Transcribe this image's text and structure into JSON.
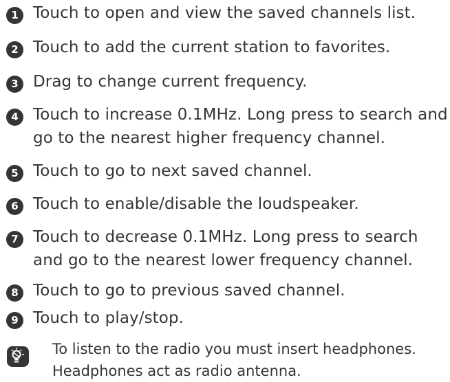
{
  "items": [
    {
      "number": "1",
      "lines": [
        "Touch to open and view the saved channels list."
      ]
    },
    {
      "number": "2",
      "lines": [
        "Touch to add the current station to favorites."
      ]
    },
    {
      "number": "3",
      "lines": [
        "Drag to change current frequency."
      ]
    },
    {
      "number": "4",
      "lines": [
        "Touch to increase 0.1MHz. Long press to search and",
        "go to the nearest higher frequency channel."
      ]
    },
    {
      "number": "5",
      "lines": [
        "Touch to go to next saved channel."
      ]
    },
    {
      "number": "6",
      "lines": [
        "Touch to enable/disable the loudspeaker."
      ]
    },
    {
      "number": "7",
      "lines": [
        "Touch to decrease 0.1MHz. Long press to search",
        "and go to the nearest lower frequency channel."
      ]
    },
    {
      "number": "8",
      "lines": [
        "Touch to go to previous saved channel."
      ]
    },
    {
      "number": "9",
      "lines": [
        "Touch to play/stop."
      ]
    }
  ],
  "tip": {
    "icon": "lightbulb-tip-icon",
    "lines": [
      "To listen to the radio you must insert headphones.",
      "Headphones act as radio antenna."
    ]
  },
  "colors": {
    "text": "#353535",
    "badge": "#353535",
    "badge_text": "#ffffff"
  }
}
